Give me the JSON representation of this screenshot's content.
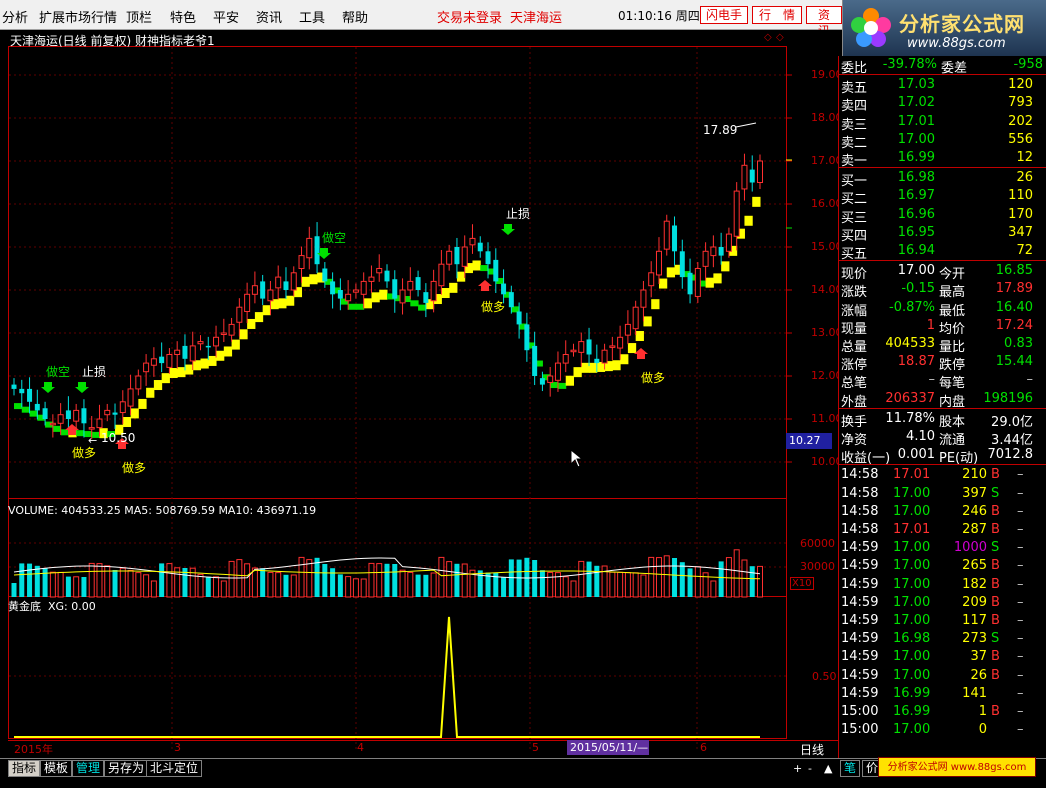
{
  "menu": {
    "items": [
      "分析",
      "扩展市场行情",
      "顶栏",
      "特色",
      "平安",
      "资讯",
      "工具",
      "帮助"
    ],
    "login_status": "交易未登录",
    "stock_name": "天津海运",
    "clock": "01:10:16 周四",
    "btn_flash": "闪电手",
    "btn_quote": "行　情",
    "btn_info": "资　讯"
  },
  "logo": {
    "title": "分析家公式网",
    "url": "www.88gs.com"
  },
  "chart_header": {
    "title": "天津海运(日线 前复权) 财神指标老爷1"
  },
  "price_axis": [
    "19.00",
    "18.00",
    "17.00",
    "16.00",
    "15.00",
    "14.00",
    "13.00",
    "12.00",
    "11.00",
    "10.00"
  ],
  "price_marker": "10.27",
  "annotations": {
    "high_label": "17.89",
    "low_label": "10.50",
    "short1": "做空",
    "stop1": "止损",
    "short2": "做空",
    "stop2": "止损",
    "long": "做多"
  },
  "volume_header": "VOLUME: 404533.25  MA5: 508769.59  MA10: 436971.19",
  "volume_axis": [
    "60000",
    "30000"
  ],
  "volume_unit": "X10",
  "gold_header_name": "黄金底",
  "gold_header_value": "XG: 0.00",
  "gold_axis": "0.50",
  "x_axis": {
    "year": "2015年",
    "m3": "3",
    "m4": "4",
    "m5": "5",
    "cursor_date": "2015/05/11/—",
    "m6": "6",
    "period": "日线"
  },
  "quote": {
    "wb": {
      "label": "委比",
      "value": "-39.78%",
      "label2": "委差",
      "value2": "-958"
    },
    "asks": [
      {
        "label": "卖五",
        "price": "17.03",
        "vol": "120"
      },
      {
        "label": "卖四",
        "price": "17.02",
        "vol": "793"
      },
      {
        "label": "卖三",
        "price": "17.01",
        "vol": "202"
      },
      {
        "label": "卖二",
        "price": "17.00",
        "vol": "556"
      },
      {
        "label": "卖一",
        "price": "16.99",
        "vol": "12"
      }
    ],
    "bids": [
      {
        "label": "买一",
        "price": "16.98",
        "vol": "26"
      },
      {
        "label": "买二",
        "price": "16.97",
        "vol": "110"
      },
      {
        "label": "买三",
        "price": "16.96",
        "vol": "170"
      },
      {
        "label": "买四",
        "price": "16.95",
        "vol": "347"
      },
      {
        "label": "买五",
        "price": "16.94",
        "vol": "72"
      }
    ],
    "stats": [
      {
        "l1": "现价",
        "v1": "17.00",
        "c1": "#ffffff",
        "l2": "今开",
        "v2": "16.85",
        "c2": "#00e000"
      },
      {
        "l1": "涨跌",
        "v1": "-0.15",
        "c1": "#00e000",
        "l2": "最高",
        "v2": "17.89",
        "c2": "#ff3030"
      },
      {
        "l1": "涨幅",
        "v1": "-0.87%",
        "c1": "#00e000",
        "l2": "最低",
        "v2": "16.40",
        "c2": "#00e000"
      },
      {
        "l1": "现量",
        "v1": "1",
        "c1": "#ff3030",
        "l2": "均价",
        "v2": "17.24",
        "c2": "#ff3030"
      },
      {
        "l1": "总量",
        "v1": "404533",
        "c1": "#ffff00",
        "l2": "量比",
        "v2": "0.83",
        "c2": "#00e000"
      },
      {
        "l1": "涨停",
        "v1": "18.87",
        "c1": "#ff3030",
        "l2": "跌停",
        "v2": "15.44",
        "c2": "#00e000"
      },
      {
        "l1": "总笔",
        "v1": "–",
        "c1": "#c0c0c0",
        "l2": "每笔",
        "v2": "–",
        "c2": "#c0c0c0"
      },
      {
        "l1": "外盘",
        "v1": "206337",
        "c1": "#ff3030",
        "l2": "内盘",
        "v2": "198196",
        "c2": "#00e000"
      }
    ],
    "fund": [
      {
        "l1": "换手",
        "v1": "11.78%",
        "l2": "股本",
        "v2": "29.0亿"
      },
      {
        "l1": "净资",
        "v1": "4.10",
        "l2": "流通",
        "v2": "3.44亿"
      },
      {
        "l1": "收益(一)",
        "v1": "0.001",
        "l2": "PE(动)",
        "v2": "7012.8"
      }
    ],
    "ticks": [
      {
        "t": "14:58",
        "p": "17.01",
        "pc": "#ff3030",
        "v": "210",
        "vc": "#ffff00",
        "s": "B",
        "sc": "#ff3030"
      },
      {
        "t": "14:58",
        "p": "17.00",
        "pc": "#00e000",
        "v": "397",
        "vc": "#ffff00",
        "s": "S",
        "sc": "#00e000"
      },
      {
        "t": "14:58",
        "p": "17.00",
        "pc": "#00e000",
        "v": "246",
        "vc": "#ffff00",
        "s": "B",
        "sc": "#ff3030"
      },
      {
        "t": "14:58",
        "p": "17.01",
        "pc": "#ff3030",
        "v": "287",
        "vc": "#ffff00",
        "s": "B",
        "sc": "#ff3030"
      },
      {
        "t": "14:59",
        "p": "17.00",
        "pc": "#00e000",
        "v": "1000",
        "vc": "#d000d0",
        "s": "S",
        "sc": "#00e000"
      },
      {
        "t": "14:59",
        "p": "17.00",
        "pc": "#00e000",
        "v": "265",
        "vc": "#ffff00",
        "s": "B",
        "sc": "#ff3030"
      },
      {
        "t": "14:59",
        "p": "17.00",
        "pc": "#00e000",
        "v": "182",
        "vc": "#ffff00",
        "s": "B",
        "sc": "#ff3030"
      },
      {
        "t": "14:59",
        "p": "17.00",
        "pc": "#00e000",
        "v": "209",
        "vc": "#ffff00",
        "s": "B",
        "sc": "#ff3030"
      },
      {
        "t": "14:59",
        "p": "17.00",
        "pc": "#00e000",
        "v": "117",
        "vc": "#ffff00",
        "s": "B",
        "sc": "#ff3030"
      },
      {
        "t": "14:59",
        "p": "16.98",
        "pc": "#00e000",
        "v": "273",
        "vc": "#ffff00",
        "s": "S",
        "sc": "#00e000"
      },
      {
        "t": "14:59",
        "p": "17.00",
        "pc": "#00e000",
        "v": "37",
        "vc": "#ffff00",
        "s": "B",
        "sc": "#ff3030"
      },
      {
        "t": "14:59",
        "p": "17.00",
        "pc": "#00e000",
        "v": "26",
        "vc": "#ffff00",
        "s": "B",
        "sc": "#ff3030"
      },
      {
        "t": "14:59",
        "p": "16.99",
        "pc": "#00e000",
        "v": "141",
        "vc": "#ffff00",
        "s": "",
        "sc": "#c0c0c0"
      },
      {
        "t": "15:00",
        "p": "16.99",
        "pc": "#00e000",
        "v": "1",
        "vc": "#ffff00",
        "s": "B",
        "sc": "#ff3030"
      },
      {
        "t": "15:00",
        "p": "17.00",
        "pc": "#00e000",
        "v": "0",
        "vc": "#ffff00",
        "s": "",
        "sc": "#c0c0c0"
      }
    ]
  },
  "bottom": {
    "tabs": [
      "指标",
      "模板",
      "管理",
      "另存为",
      "北斗定位"
    ],
    "banner": "分析家公式网 www.88gs.com",
    "side_tab1": "笔",
    "side_tab2": "价"
  }
}
